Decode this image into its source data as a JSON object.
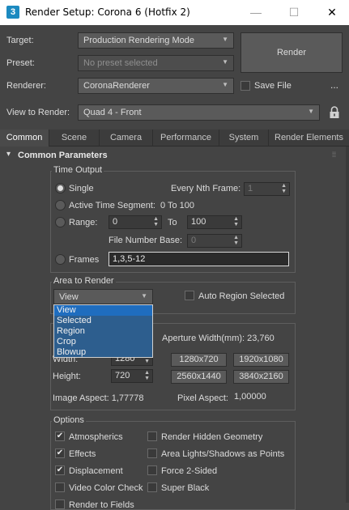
{
  "window": {
    "icon": "3",
    "title": "Render Setup: Corona 6 (Hotfix 2)",
    "minimize": "—",
    "maximize": "☐",
    "close": "✕"
  },
  "top": {
    "target_label": "Target:",
    "target_value": "Production Rendering Mode",
    "preset_label": "Preset:",
    "preset_value": "No preset selected",
    "renderer_label": "Renderer:",
    "renderer_value": "CoronaRenderer",
    "save_file_label": "Save File",
    "more_label": "...",
    "view_label": "View to Render:",
    "view_value": "Quad 4 - Front",
    "render_button": "Render"
  },
  "tabs": [
    {
      "label": "Common"
    },
    {
      "label": "Scene"
    },
    {
      "label": "Camera"
    },
    {
      "label": "Performance"
    },
    {
      "label": "System"
    },
    {
      "label": "Render Elements"
    }
  ],
  "rollout": {
    "title": "Common Parameters",
    "collapse_glyph": "▾",
    "grip": "⁞⁞"
  },
  "time_output": {
    "title": "Time Output",
    "single": "Single",
    "every_nth_label": "Every Nth Frame:",
    "every_nth_value": "1",
    "active_segment": "Active Time Segment:",
    "active_segment_value": "0 To 100",
    "range": "Range:",
    "range_from": "0",
    "range_to_label": "To",
    "range_to": "100",
    "file_base_label": "File Number Base:",
    "file_base_value": "0",
    "frames": "Frames",
    "frames_value": "1,3,5-12"
  },
  "area_to_render": {
    "title": "Area to Render",
    "selected": "View",
    "auto_region": "Auto Region Selected",
    "options": [
      "View",
      "Selected",
      "Region",
      "Crop",
      "Blowup"
    ]
  },
  "output_size": {
    "aperture": "Aperture Width(mm): 23,760",
    "width_label": "Width:",
    "width_value": "1280",
    "height_label": "Height:",
    "height_value": "720",
    "presets": [
      "1280x720",
      "1920x1080",
      "2560x1440",
      "3840x2160"
    ],
    "image_aspect": "Image Aspect: 1,77778",
    "pixel_aspect_label": "Pixel Aspect:",
    "pixel_aspect_value": "1,00000"
  },
  "options": {
    "title": "Options",
    "atmospherics": "Atmospherics",
    "effects": "Effects",
    "displacement": "Displacement",
    "video_color_check": "Video Color Check",
    "render_to_fields": "Render to Fields",
    "render_hidden": "Render Hidden Geometry",
    "area_lights": "Area Lights/Shadows as Points",
    "force_2sided": "Force 2-Sided",
    "super_black": "Super Black"
  }
}
